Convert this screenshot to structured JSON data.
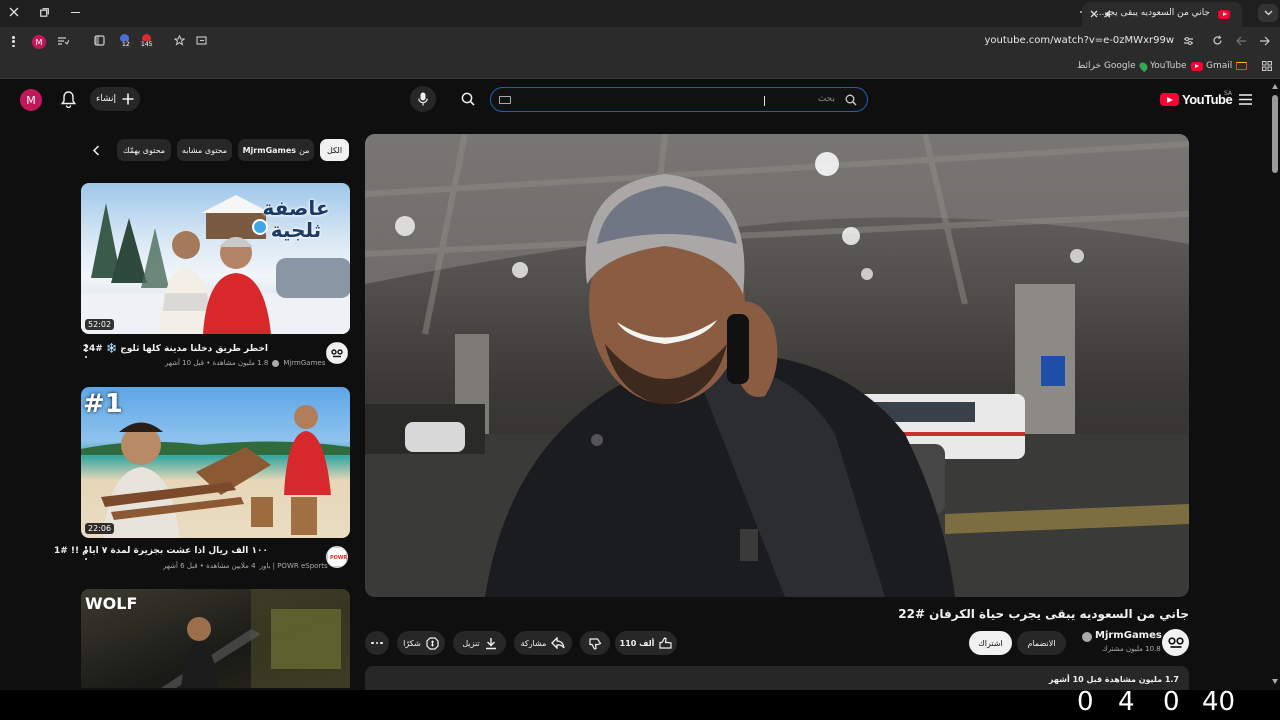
{
  "browser": {
    "tab_title": "جاني من السعوديه يبقى يجر...",
    "url": "youtube.com/watch?v=e-0zMWxr99w",
    "profile_letter": "M",
    "extension_badges": [
      "12",
      "145"
    ],
    "bookmarks": [
      {
        "label": "YouTube",
        "icon": "youtube-icon"
      },
      {
        "label": "Gmail",
        "icon": "gmail-icon"
      },
      {
        "label": "خرائط Google",
        "icon": "maps-icon"
      }
    ]
  },
  "header": {
    "logo_text": "YouTube",
    "logo_sup": "SA",
    "search_placeholder": "بحث",
    "create_label": "إنشاء",
    "avatar_letter": "M"
  },
  "chips": {
    "all": "الكل",
    "from_prefix": "من",
    "from_channel": "MjrmGames",
    "similar": "محتوى مشابه",
    "for_you": "محتوى يهمّك"
  },
  "recommendations": [
    {
      "title": "اخطر طريق دخلنا مدينة كلها ثلوج ❄️ #24",
      "channel": "MjrmGames",
      "meta": "1.8 مليون مشاهدة • قبل 10 أشهر",
      "duration": "52:02",
      "thumb_text": "عاصفة ثلجية"
    },
    {
      "title": "١٠٠ الف ريال اذا عشت بجزيرة لمدة ٧ ايام !! #1",
      "channel": "باور | POWR eSports",
      "meta": "4 ملايين مشاهدة • قبل 6 أشهر",
      "duration": "22:06",
      "thumb_text": "#1"
    },
    {
      "thumb_text": "WOLF"
    }
  ],
  "video": {
    "title": "جاني من السعوديه يبقى يجرب حياة الكرفان #22",
    "channel": "MjrmGames",
    "subscribers": "10.8 مليون مشترك",
    "join_label": "الانضمام",
    "subscribe_label": "اشتراك",
    "likes": "110 ألف",
    "share_label": "مشاركة",
    "download_label": "تنزيل",
    "thanks_label": "شكرًا",
    "description_head": "1.7 مليون مشاهدة  قبل 10 أشهر"
  },
  "overlay_counter": [
    "0",
    "4",
    "0",
    "40"
  ],
  "colors": {
    "background": "#0f0f0f",
    "chip": "#272727",
    "brand_red": "#ff0033",
    "search_border": "#1c62b9"
  }
}
